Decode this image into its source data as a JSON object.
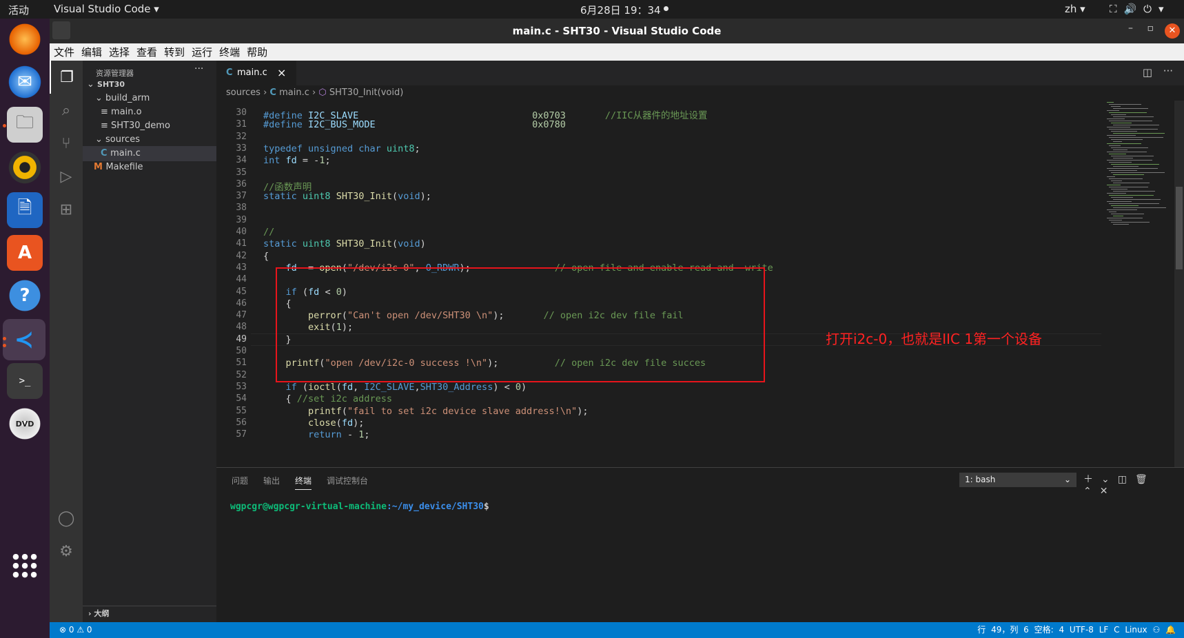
{
  "topbar": {
    "activities": "活动",
    "app": "Visual Studio Code ▾",
    "clock": "6月28日 19：34",
    "lang": "zh ▾",
    "sys": "⛶🔊⏻▾"
  },
  "dock": [
    "firefox-icon",
    "thunderbird-icon",
    "files-icon",
    "rhythmbox-icon",
    "writer-icon",
    "software-icon",
    "help-icon",
    "vscode-icon",
    "terminal-icon",
    "dvd-icon"
  ],
  "window": {
    "title": "main.c - SHT30 - Visual Studio Code",
    "minimize": "–",
    "maximize": "▫",
    "close": "✕"
  },
  "menu": [
    "文件",
    "编辑",
    "选择",
    "查看",
    "转到",
    "运行",
    "终端",
    "帮助"
  ],
  "sidebar": {
    "header": "资源管理器",
    "more": "···",
    "tree": [
      {
        "label": "SHT30",
        "indent": 6,
        "prefix": "⌄",
        "bold": true
      },
      {
        "label": "build_arm",
        "indent": 18,
        "prefix": "⌄"
      },
      {
        "label": "main.o",
        "indent": 26,
        "prefix": "≡"
      },
      {
        "label": "SHT30_demo",
        "indent": 26,
        "prefix": "≡"
      },
      {
        "label": "sources",
        "indent": 18,
        "prefix": "⌄"
      },
      {
        "label": "main.c",
        "indent": 26,
        "prefix": "C",
        "selected": true
      },
      {
        "label": "Makefile",
        "indent": 16,
        "prefix": "M"
      }
    ],
    "outline": "大纲"
  },
  "tab": {
    "icon": "C",
    "label": "main.c",
    "close": "×"
  },
  "breadcrumb": {
    "p1": "sources",
    "p2": "main.c",
    "p3": "SHT30_Init(void)"
  },
  "editor": {
    "lines": [
      {
        "n": "30",
        "html": "<span class='mc'>#define</span> <span class='vr'>I2C_SLAVE</span>                               <span class='nm'>0x0703</span>       <span class='cm'>//IIC从器件的地址设置</span>"
      },
      {
        "n": "31",
        "html": "<span class='mc'>#define</span> <span class='vr'>I2C_BUS_MODE</span>                            <span class='nm'>0x0780</span>"
      },
      {
        "n": "32",
        "html": ""
      },
      {
        "n": "33",
        "html": "<span class='kw'>typedef</span> <span class='kw'>unsigned</span> <span class='kw'>char</span> <span class='ty'>uint8</span>;"
      },
      {
        "n": "34",
        "html": "<span class='kw'>int</span> <span class='vr'>fd</span> = -<span class='nm'>1</span>;"
      },
      {
        "n": "35",
        "html": ""
      },
      {
        "n": "36",
        "html": "<span class='cm'>//函数声明</span>"
      },
      {
        "n": "37",
        "html": "<span class='kw'>static</span> <span class='ty'>uint8</span> <span class='fn'>SHT30_Init</span>(<span class='kw'>void</span>);"
      },
      {
        "n": "38",
        "html": ""
      },
      {
        "n": "39",
        "html": ""
      },
      {
        "n": "40",
        "html": "<span class='cm'>//</span>"
      },
      {
        "n": "41",
        "html": "<span class='kw'>static</span> <span class='ty'>uint8</span> <span class='fn'>SHT30_Init</span>(<span class='kw'>void</span>)"
      },
      {
        "n": "42",
        "html": "{"
      },
      {
        "n": "43",
        "html": "    <span class='vr'>fd</span>  = <span class='fn'>open</span>(<span class='st'>\"/dev/i2c-0\"</span>, <span class='kw'>O_RDWR</span>);               <span class='cm'>// open file and enable read and  write</span>"
      },
      {
        "n": "44",
        "html": ""
      },
      {
        "n": "45",
        "html": "    <span class='kw'>if</span> (<span class='vr'>fd</span> &lt; <span class='nm'>0</span>)"
      },
      {
        "n": "46",
        "html": "    {"
      },
      {
        "n": "47",
        "html": "        <span class='fn'>perror</span>(<span class='st'>\"Can't open /dev/SHT30 \\n\"</span>);       <span class='cm'>// open i2c dev file fail</span>"
      },
      {
        "n": "48",
        "html": "        <span class='fn'>exit</span>(<span class='nm'>1</span>);"
      },
      {
        "n": "49",
        "html": "    }",
        "cur": true
      },
      {
        "n": "50",
        "html": ""
      },
      {
        "n": "51",
        "html": "    <span class='fn'>printf</span>(<span class='st'>\"open /dev/i2c-0 success !\\n\"</span>);          <span class='cm'>// open i2c dev file succes</span>"
      },
      {
        "n": "52",
        "html": ""
      },
      {
        "n": "53",
        "html": "    <span class='kw'>if</span> (<span class='fn'>ioctl</span>(<span class='vr'>fd</span>, <span class='kw'>I2C_SLAVE</span>,<span class='kw'>SHT30_Address</span>) &lt; <span class='nm'>0</span>)"
      },
      {
        "n": "54",
        "html": "    { <span class='cm'>//set i2c address</span>"
      },
      {
        "n": "55",
        "html": "        <span class='fn'>printf</span>(<span class='st'>\"fail to set i2c device slave address!\\n\"</span>);"
      },
      {
        "n": "56",
        "html": "        <span class='fn'>close</span>(<span class='vr'>fd</span>);"
      },
      {
        "n": "57",
        "html": "        <span class='kw'>return</span> - <span class='nm'>1</span>;"
      }
    ],
    "annotation": "打开i2c-0，也就是IIC 1第一个设备"
  },
  "panel": {
    "tabs": [
      "问题",
      "输出",
      "终端",
      "调试控制台"
    ],
    "active_tab": "终端",
    "terminal_select": "1: bash",
    "prompt_user": "wgpcgr@wgpcgr-virtual-machine",
    "prompt_path": ":~/my_device/SHT30",
    "prompt_end": "$"
  },
  "status": {
    "left": "⊗ 0 ⚠ 0",
    "right": "行 49，列 6   空格: 4   UTF-8   LF   C   Linux   ⚇   🔔"
  },
  "colors": {
    "accent": "#007acc",
    "annotation": "#e8141b",
    "prompt_green": "#0dbc79",
    "prompt_blue": "#3b8eea"
  }
}
